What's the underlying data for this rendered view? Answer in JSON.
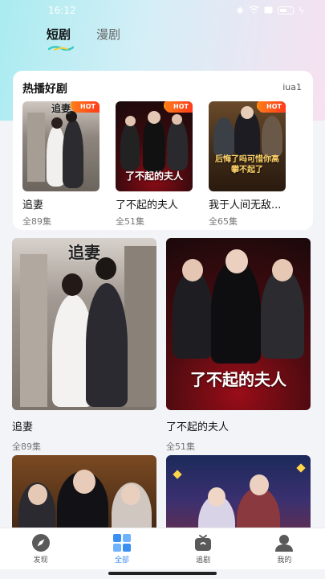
{
  "status_bar": {
    "time": "16:12",
    "battery": "38"
  },
  "tabs": [
    {
      "label": "短剧",
      "active": true
    },
    {
      "label": "漫剧",
      "active": false
    }
  ],
  "hot_section": {
    "title": "热播好剧",
    "more": "iua1",
    "items": [
      {
        "name": "追妻",
        "episodes": "全89集",
        "badge": "HOT",
        "poster_text": "追妻"
      },
      {
        "name": "了不起的夫人",
        "episodes": "全51集",
        "badge": "HOT",
        "poster_text": "了不起的夫人"
      },
      {
        "name": "我于人间无敌...",
        "episodes": "全65集",
        "badge": "HOT",
        "poster_text": "后悔了吗可惜你高攀不起了"
      }
    ]
  },
  "grid": [
    {
      "name": "追妻",
      "episodes": "全89集",
      "poster_text": "追妻"
    },
    {
      "name": "了不起的夫人",
      "episodes": "全51集",
      "poster_text": "了不起的夫人"
    }
  ],
  "bottom_posters": [
    {
      "poster_text": ""
    },
    {
      "poster_text": ""
    }
  ],
  "nav": [
    {
      "label": "发现",
      "icon": "compass-icon",
      "active": false
    },
    {
      "label": "全部",
      "icon": "grid-icon",
      "active": true
    },
    {
      "label": "追剧",
      "icon": "tv-icon",
      "active": false
    },
    {
      "label": "我的",
      "icon": "user-icon",
      "active": false
    }
  ],
  "colors": {
    "accent": "#3a8ff0",
    "hot": "#ff4b1a"
  }
}
